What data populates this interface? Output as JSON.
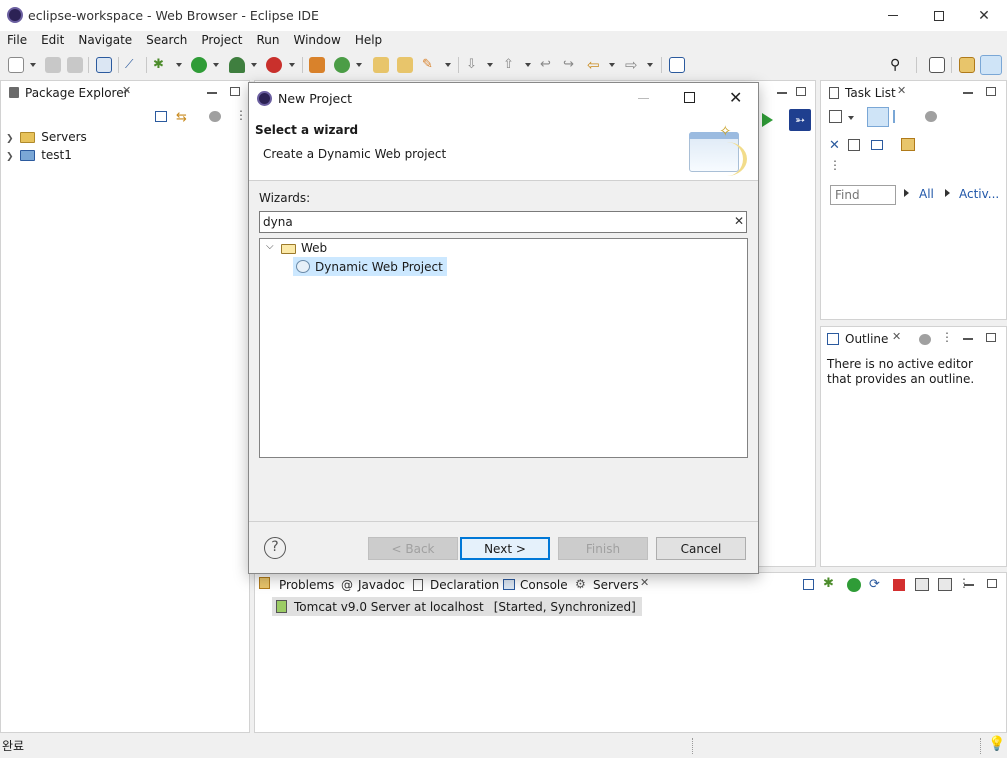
{
  "window": {
    "title": "eclipse-workspace - Web Browser - Eclipse IDE"
  },
  "menu": [
    "File",
    "Edit",
    "Navigate",
    "Search",
    "Project",
    "Run",
    "Window",
    "Help"
  ],
  "package_explorer": {
    "title": "Package Explorer",
    "items": [
      {
        "label": "Servers"
      },
      {
        "label": "test1"
      }
    ]
  },
  "task_list": {
    "title": "Task List",
    "find_placeholder": "Find",
    "all_label": "All",
    "activate_label": "Activ..."
  },
  "outline": {
    "title": "Outline",
    "message": "There is no active editor that provides an outline."
  },
  "bottom_panel": {
    "tabs": [
      "Problems",
      "Javadoc",
      "Declaration",
      "Console",
      "Servers"
    ],
    "server_name": "Tomcat v9.0 Server at localhost",
    "server_status": "[Started, Synchronized]"
  },
  "dialog": {
    "title": "New Project",
    "heading": "Select a wizard",
    "subtitle": "Create a Dynamic Web project",
    "wizards_label": "Wizards:",
    "filter_value": "dyna",
    "tree": {
      "folder": "Web",
      "item": "Dynamic Web Project"
    },
    "buttons": {
      "back": "< Back",
      "next": "Next >",
      "finish": "Finish",
      "cancel": "Cancel"
    }
  },
  "status": {
    "text": "완료"
  },
  "colors": {
    "accent": "#0078d7",
    "selection": "#cce8ff",
    "eclipse": "#2c2255"
  }
}
